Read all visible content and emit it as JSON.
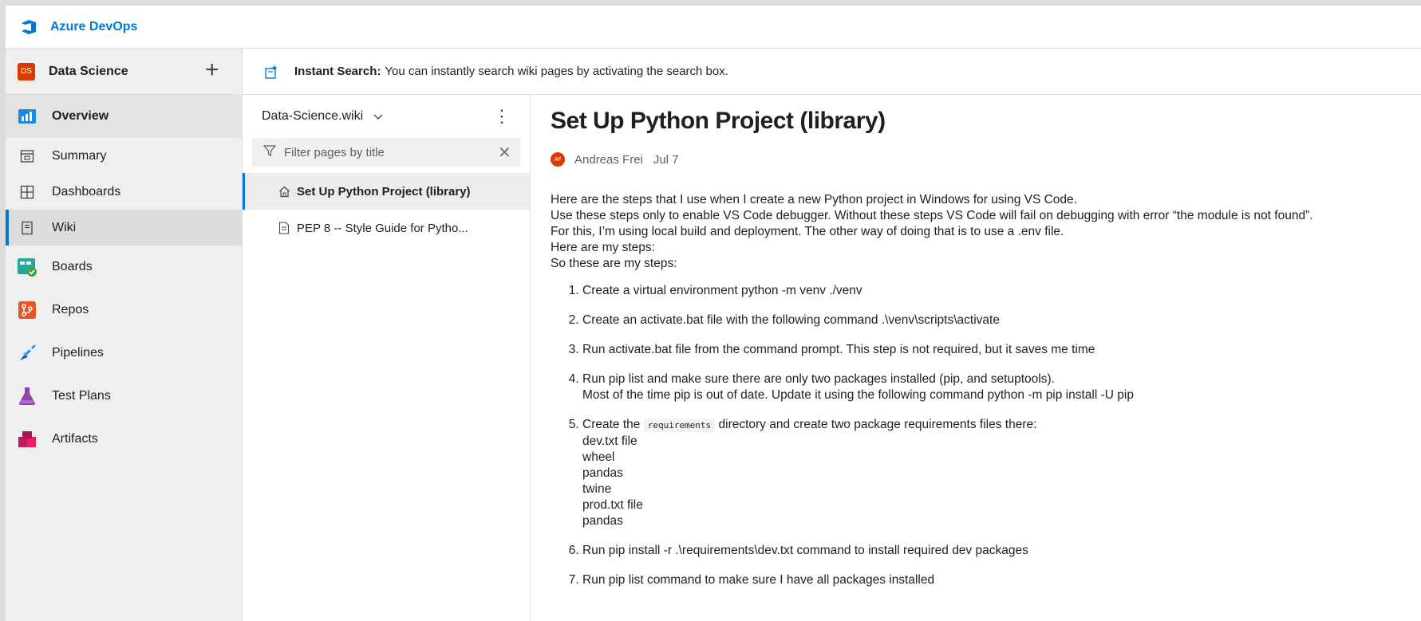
{
  "topbar": {
    "brand": "Azure DevOps"
  },
  "project": {
    "initials": "DS",
    "name": "Data Science",
    "add_icon": "plus-icon"
  },
  "nav": {
    "items": [
      {
        "label": "Overview",
        "icon": "overview-icon"
      },
      {
        "label": "Summary",
        "icon": "summary-icon"
      },
      {
        "label": "Dashboards",
        "icon": "dashboards-icon"
      },
      {
        "label": "Wiki",
        "icon": "wiki-icon"
      },
      {
        "label": "Boards",
        "icon": "boards-icon"
      },
      {
        "label": "Repos",
        "icon": "repos-icon"
      },
      {
        "label": "Pipelines",
        "icon": "pipelines-icon"
      },
      {
        "label": "Test Plans",
        "icon": "test-plans-icon"
      },
      {
        "label": "Artifacts",
        "icon": "artifacts-icon"
      }
    ]
  },
  "banner": {
    "title": "Instant Search:",
    "text": "You can instantly search wiki pages by activating the search box."
  },
  "tree": {
    "wiki_name": "Data-Science.wiki",
    "filter_placeholder": "Filter pages by title",
    "pages": [
      {
        "label": "Set Up Python Project (library)"
      },
      {
        "label": "PEP 8 -- Style Guide for Pytho..."
      }
    ]
  },
  "page": {
    "title": "Set Up Python Project (library)",
    "author_initials": "AF",
    "author": "Andreas Frei",
    "date": "Jul 7",
    "intro": [
      "Here are the steps that I use when I create a new Python project in Windows for using VS Code.",
      "Use these steps only to enable VS Code debugger. Without these steps VS Code will fail on debugging with error “the module is not found”.",
      "For this, I’m using local build and deployment. The other way of doing that is to use a .env file.",
      "Here are my steps:",
      "So these are my steps:"
    ],
    "steps": {
      "s1": "Create a virtual environment python -m venv ./venv",
      "s2": "Create an activate.bat file with the following command .\\venv\\scripts\\activate",
      "s3": "Run activate.bat file from the command prompt. This step is not required, but it saves me time",
      "s4a": "Run pip list and make sure there are only two packages installed (pip, and setuptools).",
      "s4b": "Most of the time pip is out of date. Update it using the following command python -m pip install -U pip",
      "s5_pre": "Create the",
      "s5_code": "requirements",
      "s5_post": "directory and create two package requirements files there:",
      "s5_lines": [
        "dev.txt file",
        "wheel",
        "pandas",
        "twine",
        "prod.txt file",
        "pandas"
      ],
      "s6": "Run pip install -r .\\requirements\\dev.txt command to install required dev packages",
      "s7": "Run pip list command to make sure I have all packages installed"
    }
  }
}
